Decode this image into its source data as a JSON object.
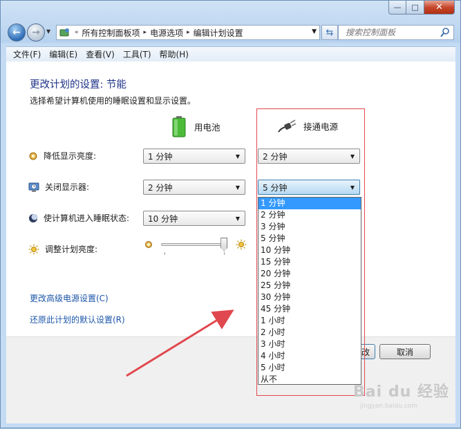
{
  "window": {
    "minimize_glyph": "—",
    "maximize_glyph": "□",
    "close_glyph": "✕"
  },
  "address": {
    "history_glyph": "«",
    "breadcrumbs": [
      "所有控制面板项",
      "电源选项",
      "编辑计划设置"
    ],
    "separator": "▸"
  },
  "search": {
    "placeholder": "搜索控制面板"
  },
  "menu": [
    "文件(F)",
    "编辑(E)",
    "查看(V)",
    "工具(T)",
    "帮助(H)"
  ],
  "page": {
    "title": "更改计划的设置: 节能",
    "subtitle": "选择希望计算机使用的睡眠设置和显示设置。"
  },
  "columns": {
    "battery": "用电池",
    "plugged": "接通电源"
  },
  "rows": {
    "dim": {
      "label": "降低显示亮度:",
      "battery": "1 分钟",
      "plugged": "2 分钟"
    },
    "display_off": {
      "label": "关闭显示器:",
      "battery": "2 分钟",
      "plugged": "5 分钟"
    },
    "sleep": {
      "label": "使计算机进入睡眠状态:",
      "battery": "10 分钟"
    },
    "brightness": {
      "label": "调整计划亮度:",
      "level_percent": 95
    }
  },
  "dropdown": {
    "options": [
      "1 分钟",
      "2 分钟",
      "3 分钟",
      "5 分钟",
      "10 分钟",
      "15 分钟",
      "20 分钟",
      "25 分钟",
      "30 分钟",
      "45 分钟",
      "1 小时",
      "2 小时",
      "3 小时",
      "4 小时",
      "5 小时",
      "从不"
    ],
    "highlighted": "1 分钟"
  },
  "links": {
    "advanced": "更改高级电源设置(C)",
    "restore": "还原此计划的默认设置(R)"
  },
  "buttons": {
    "save": "改",
    "cancel": "取消"
  },
  "watermark": {
    "brand": "Bai du 经验",
    "url": "jingyan.baidu.com"
  },
  "colors": {
    "highlight": "#3399ff",
    "annotation": "#e1474e",
    "link": "#1c56a8",
    "title": "#1e3287"
  }
}
